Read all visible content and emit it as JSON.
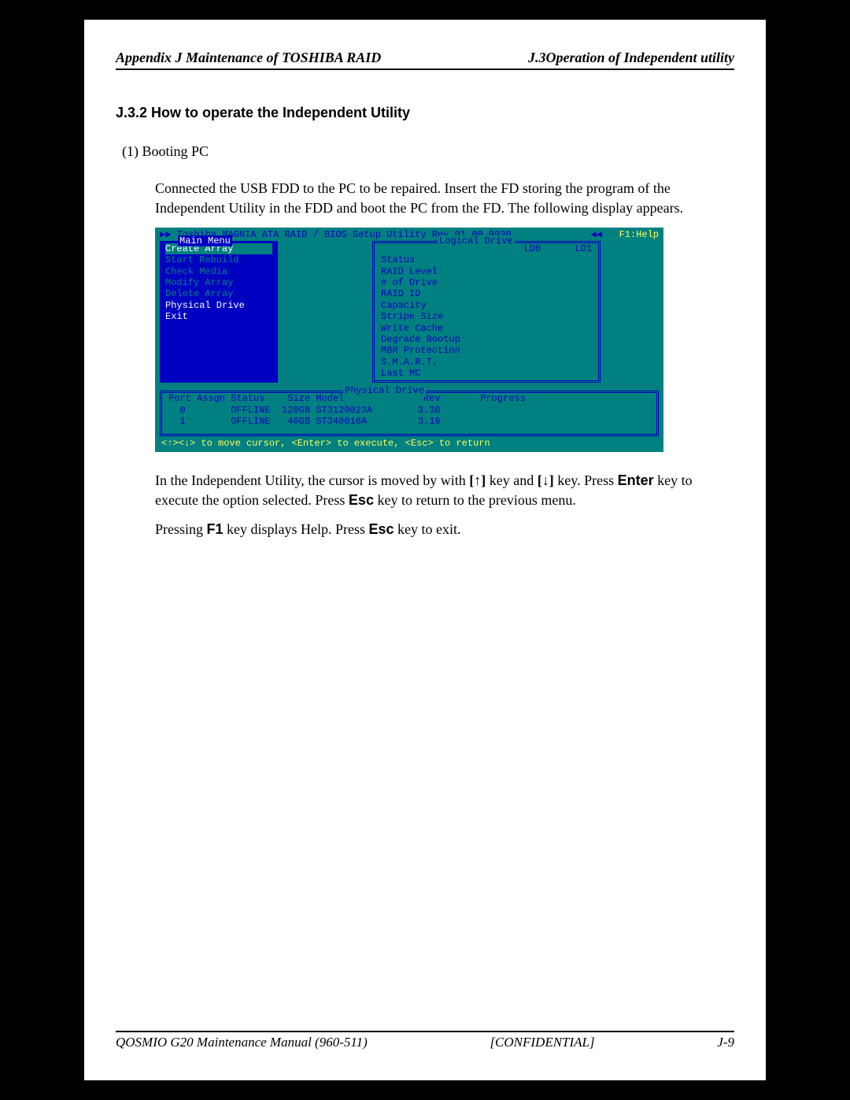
{
  "header": {
    "left": "Appendix J Maintenance of TOSHIBA RAID",
    "right": "J.3Operation of Independent utility"
  },
  "section_title": "J.3.2  How to operate the Independent Utility",
  "step1_label": "(1) Booting PC",
  "para1": "Connected the USB FDD to the PC to be repaired. Insert the FD storing the program of the Independent Utility in the FDD and boot the PC from the FD. The following display appears.",
  "bios": {
    "title_arrows_l": "▶▶ ",
    "title_main": "Toshiba MAGNIA ATA RAID / BIOS Setup Utility Rev 01.00.9030 ",
    "title_arrows_r": " ◀◀   ",
    "help": "F1:Help",
    "main_menu_title": "Main Menu",
    "menu": {
      "create": "Create Array",
      "rebuild": "Start Rebuild",
      "check": "Check Media",
      "modify": "Modify Array",
      "delete": "Delete Array",
      "physical": "Physical Drive",
      "exit": "Exit"
    },
    "logical_title": "Logical Drive",
    "logical_head": "                LD0      LD1",
    "logical_rows": [
      "Status",
      "RAID Level",
      "# of Drive",
      "RAID ID",
      "Capacity",
      "Stripe Size",
      "Write Cache",
      "Degrade Bootup",
      "MBR Protection",
      "S.M.A.R.T.",
      "Last MC"
    ],
    "phys_title": "Physical Drive",
    "phys_head": "Port Assgn Status    Size Model              Rev       Progress",
    "phys_rows": [
      "  0        OFFLINE  120GB ST3120023A        3.30",
      "  1        OFFLINE   40GB ST340016A         3.19"
    ],
    "footer": "<↑><↓> to move cursor, <Enter> to execute, <Esc> to return"
  },
  "para2": {
    "a": "In the Independent Utility, the cursor is moved by with ",
    "up": "[↑]",
    "b": " key and ",
    "down": "[↓]",
    "c": " key. Press ",
    "enter": "Enter",
    "d": " key to execute the option selected. Press ",
    "esc": "Esc",
    "e": " key to return to the previous menu."
  },
  "para3": {
    "a": "Pressing ",
    "f1": "F1",
    "b": " key displays Help. Press ",
    "esc": "Esc",
    "c": " key to exit."
  },
  "footer": {
    "left": "QOSMIO G20 Maintenance Manual (960-511)",
    "mid": "[CONFIDENTIAL]",
    "right": "J-9"
  }
}
